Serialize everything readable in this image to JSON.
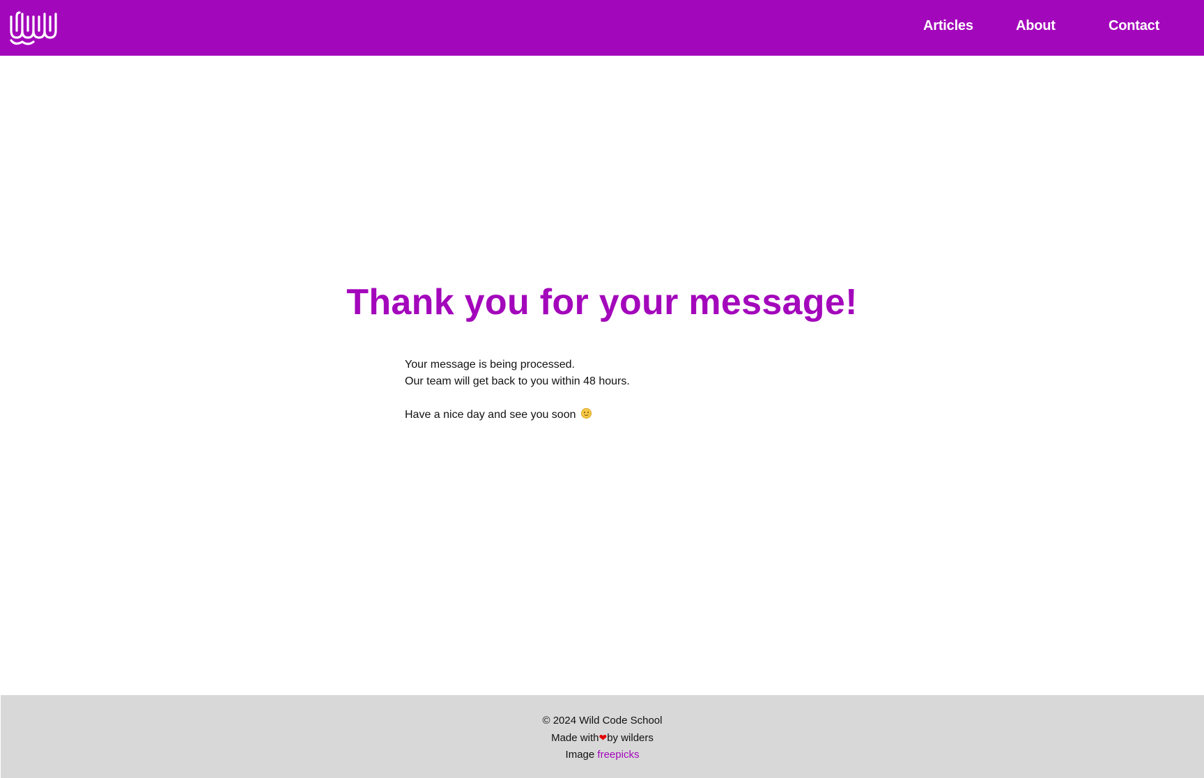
{
  "header": {
    "logo_icon": "wild-code-school-logo-icon",
    "nav": {
      "articles": "Articles",
      "about": "About",
      "contact": "Contact"
    }
  },
  "main": {
    "title": "Thank you for your message!",
    "line1": "Your message is being processed.",
    "line2": "Our team will get back to you within 48 hours.",
    "line3": "Have a nice day and see you soon",
    "emoji_icon": "smiley-face-icon"
  },
  "footer": {
    "copyright": "© 2024 Wild Code School",
    "made_with_prefix": "Made with",
    "heart_icon": "heart-icon",
    "heart_glyph": "❤",
    "made_with_suffix": "by wilders",
    "image_prefix": "Image",
    "image_link": "freepicks"
  },
  "colors": {
    "brand": "#a307bb",
    "footer_bg": "#d8d8d8",
    "heart": "#e30000"
  }
}
